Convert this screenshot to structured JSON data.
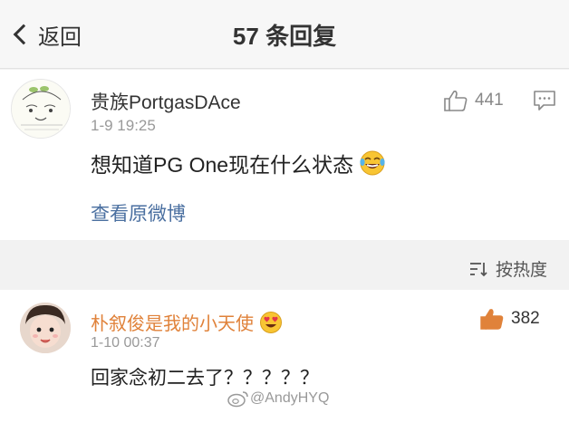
{
  "header": {
    "back_label": "返回",
    "title": "57 条回复"
  },
  "post": {
    "username": "贵族PortgasDAce",
    "time": "1-9 19:25",
    "likes": "441",
    "content": "想知道PG One现在什么状态",
    "content_emoji": "laughing-tears-emoji",
    "view_original": "查看原微博"
  },
  "sort": {
    "label": "按热度",
    "icon": "sort-icon"
  },
  "reply": {
    "username": "朴叙俊是我的小天使",
    "badge": "heart-eyes-emoji",
    "time": "1-10 00:37",
    "likes": "382",
    "content": "回家念初二去了？？？？？"
  },
  "watermark": {
    "text": "@AndyHYQ"
  },
  "colors": {
    "link": "#4a6fa0",
    "reply_username": "#e0823a",
    "liked_icon": "#e0823a"
  }
}
